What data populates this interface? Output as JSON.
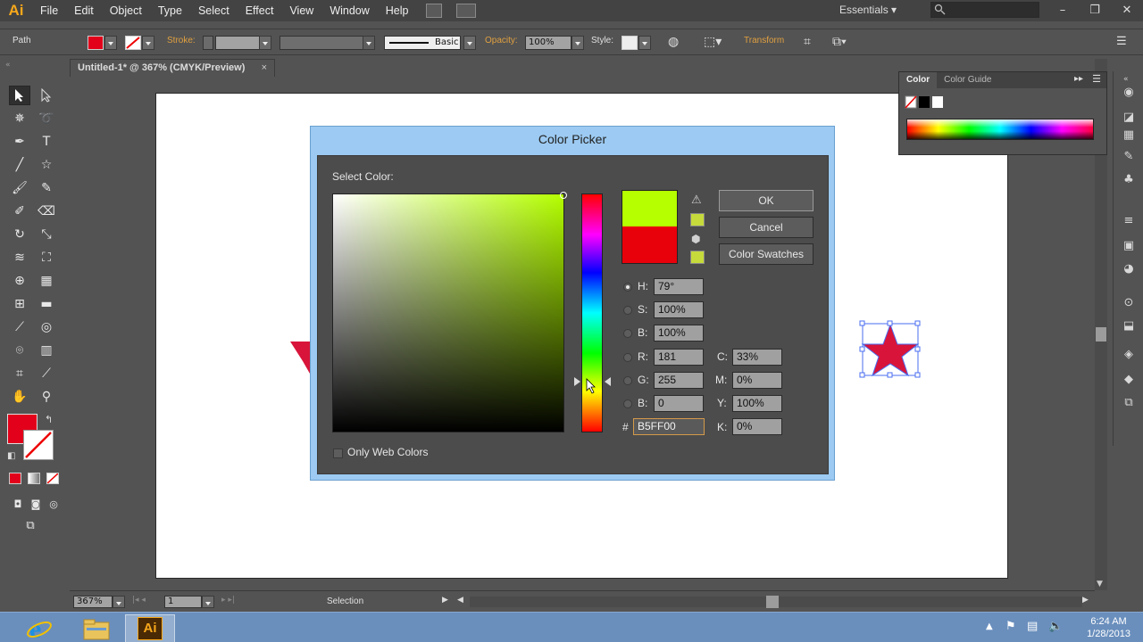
{
  "app": {
    "logo": "Ai",
    "menu": [
      "File",
      "Edit",
      "Object",
      "Type",
      "Select",
      "Effect",
      "View",
      "Window",
      "Help"
    ],
    "workspace": "Essentials"
  },
  "control_bar": {
    "selection_type": "Path",
    "stroke_label": "Stroke:",
    "stroke_style": "Basic",
    "opacity_label": "Opacity:",
    "opacity_value": "100%",
    "style_label": "Style:",
    "transform_label": "Transform"
  },
  "document": {
    "tab_title": "Untitled-1* @ 367% (CMYK/Preview)",
    "tab_close": "×"
  },
  "color_panel": {
    "tabs": [
      "Color",
      "Color Guide"
    ]
  },
  "color_picker": {
    "title": "Color Picker",
    "select_label": "Select Color:",
    "buttons": {
      "ok": "OK",
      "cancel": "Cancel",
      "swatches": "Color Swatches"
    },
    "new_color": "#b5ff00",
    "old_color": "#e8000b",
    "fields": {
      "h": {
        "label": "H:",
        "value": "79°"
      },
      "s": {
        "label": "S:",
        "value": "100%"
      },
      "b": {
        "label": "B:",
        "value": "100%"
      },
      "r": {
        "label": "R:",
        "value": "181"
      },
      "g": {
        "label": "G:",
        "value": "255"
      },
      "bl": {
        "label": "B:",
        "value": "0"
      },
      "hex": {
        "label": "#",
        "value": "B5FF00"
      },
      "c": {
        "label": "C:",
        "value": "33%"
      },
      "m": {
        "label": "M:",
        "value": "0%"
      },
      "y": {
        "label": "Y:",
        "value": "100%"
      },
      "k": {
        "label": "K:",
        "value": "0%"
      }
    },
    "web_only_label": "Only Web Colors"
  },
  "status_bar": {
    "zoom": "367%",
    "page": "1",
    "tool": "Selection"
  },
  "taskbar": {
    "active_app": "Ai",
    "time": "6:24 AM",
    "date": "1/28/2013"
  },
  "colors": {
    "fill": "#e2001a",
    "star": "#d8143a",
    "accent_orange": "#f7a81b",
    "dialog_frame": "#9ccaf2"
  }
}
